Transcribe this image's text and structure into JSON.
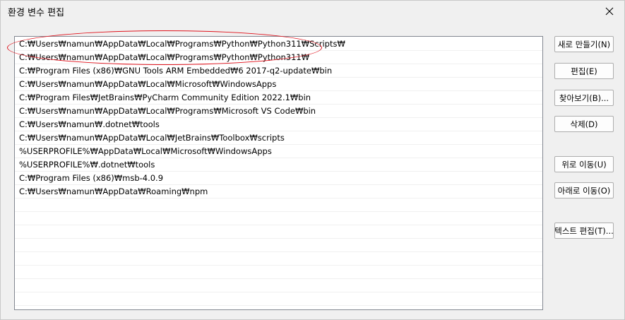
{
  "window": {
    "title": "환경 변수 편집"
  },
  "paths": [
    "C:₩Users₩namun₩AppData₩Local₩Programs₩Python₩Python311₩Scripts₩",
    "C:₩Users₩namun₩AppData₩Local₩Programs₩Python₩Python311₩",
    "C:₩Program Files (x86)₩GNU Tools ARM Embedded₩6 2017-q2-update₩bin",
    "C:₩Users₩namun₩AppData₩Local₩Microsoft₩WindowsApps",
    "C:₩Program Files₩JetBrains₩PyCharm Community Edition 2022.1₩bin",
    "C:₩Users₩namun₩AppData₩Local₩Programs₩Microsoft VS Code₩bin",
    "C:₩Users₩namun₩.dotnet₩tools",
    "C:₩Users₩namun₩AppData₩Local₩JetBrains₩Toolbox₩scripts",
    "%USERPROFILE%₩AppData₩Local₩Microsoft₩WindowsApps",
    "%USERPROFILE%₩.dotnet₩tools",
    "C:₩Program Files (x86)₩msb-4.0.9",
    "C:₩Users₩namun₩AppData₩Roaming₩npm"
  ],
  "buttons": {
    "new": "새로 만들기(N)",
    "edit": "편집(E)",
    "browse": "찾아보기(B)...",
    "delete": "삭제(D)",
    "move_up": "위로 이동(U)",
    "move_down": "아래로 이동(O)",
    "edit_text": "텍스트 편집(T)..."
  },
  "colors": {
    "annotation": "#e0141e"
  }
}
